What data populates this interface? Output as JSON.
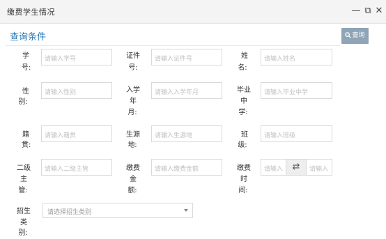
{
  "window": {
    "title": "缴费学生情况",
    "minimize_glyph": "—",
    "restore_glyph": "⧉",
    "close_glyph": "✕"
  },
  "panel": {
    "title": "查询条件",
    "query_button": "查询",
    "query_icon": "search-icon"
  },
  "fields": {
    "student_id": {
      "label": [
        "学",
        "号:"
      ],
      "placeholder": "请输入学号"
    },
    "id_card": {
      "label": [
        "证件",
        "号:"
      ],
      "placeholder": "请输入证件号"
    },
    "name": {
      "label": [
        "姓",
        "名:"
      ],
      "placeholder": "请输入姓名"
    },
    "gender": {
      "label": [
        "性",
        "别:"
      ],
      "placeholder": "请输入性别"
    },
    "enroll_year": {
      "label": [
        "入学",
        "年",
        "月:"
      ],
      "placeholder": "请输入入学年月"
    },
    "middle_school": {
      "label": [
        "毕业",
        "中",
        "学:"
      ],
      "placeholder": "请输入毕业中学"
    },
    "native_place": {
      "label": [
        "籍",
        "贯:"
      ],
      "placeholder": "请输入籍贯"
    },
    "source_place": {
      "label": [
        "生源",
        "地:"
      ],
      "placeholder": "请输入生源地"
    },
    "class": {
      "label": [
        "班",
        "级:"
      ],
      "placeholder": "请输入班级"
    },
    "dept_head": {
      "label": [
        "二级",
        "主",
        "管:"
      ],
      "placeholder": "请输入二级主管"
    },
    "amount": {
      "label": [
        "缴费",
        "金",
        "额:"
      ],
      "placeholder": "请输入缴费金额"
    },
    "pay_time": {
      "label": [
        "缴费",
        "时",
        "间:"
      ],
      "placeholder_start": "请输入",
      "placeholder_end": "请输入",
      "swap_glyph": "⇄"
    },
    "admission_type": {
      "label": [
        "招生",
        "类",
        "别:"
      ],
      "placeholder": "请选择招生类别"
    }
  }
}
